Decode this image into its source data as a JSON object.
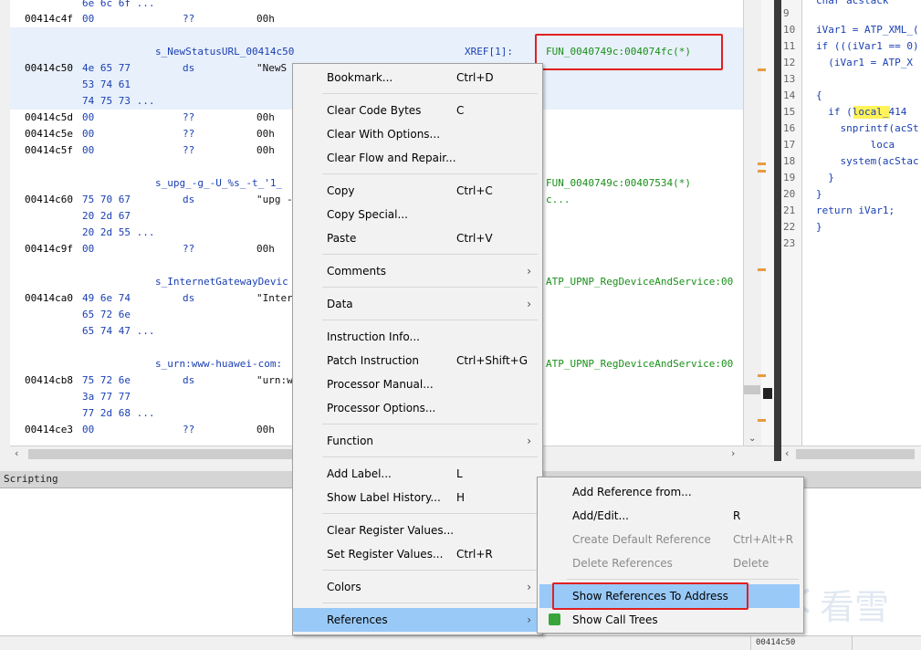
{
  "listing": {
    "lines": [
      {
        "addr": "",
        "bytes": "6e 6c 6f",
        "more": "...",
        "mnem": "",
        "val": ""
      },
      {
        "addr": "00414c4f",
        "bytes": "00",
        "more": "",
        "mnem": "??",
        "val": "00h"
      },
      {
        "label": "s_NewStatusURL_00414c50",
        "xref_label": "XREF[1]:",
        "xref": "FUN_0040749c:004074fc(*)"
      },
      {
        "addr": "00414c50",
        "bytes": "4e 65 77",
        "more": "",
        "mnem": "ds",
        "val": "\"NewS"
      },
      {
        "addr": "",
        "bytes": "53 74 61",
        "more": "",
        "mnem": "",
        "val": ""
      },
      {
        "addr": "",
        "bytes": "74 75 73",
        "more": "...",
        "mnem": "",
        "val": ""
      },
      {
        "addr": "00414c5d",
        "bytes": "00",
        "more": "",
        "mnem": "??",
        "val": "00h"
      },
      {
        "addr": "00414c5e",
        "bytes": "00",
        "more": "",
        "mnem": "??",
        "val": "00h"
      },
      {
        "addr": "00414c5f",
        "bytes": "00",
        "more": "",
        "mnem": "??",
        "val": "00h"
      },
      {
        "label": "s_upg_-g_-U_%s_-t_'1_",
        "xref_label": "",
        "xref": "FUN_0040749c:00407534(*)"
      },
      {
        "addr": "00414c60",
        "bytes": "75 70 67",
        "more": "",
        "mnem": "ds",
        "val": "\"upg -",
        "xref_tail": "c..."
      },
      {
        "addr": "",
        "bytes": "20 2d 67",
        "more": "",
        "mnem": "",
        "val": ""
      },
      {
        "addr": "",
        "bytes": "20 2d 55",
        "more": "...",
        "mnem": "",
        "val": ""
      },
      {
        "addr": "00414c9f",
        "bytes": "00",
        "more": "",
        "mnem": "??",
        "val": "00h"
      },
      {
        "label": "s_InternetGatewayDevic",
        "xref_label": "",
        "xref": "ATP_UPNP_RegDeviceAndService:00"
      },
      {
        "addr": "00414ca0",
        "bytes": "49 6e 74",
        "more": "",
        "mnem": "ds",
        "val": "\"Inter"
      },
      {
        "addr": "",
        "bytes": "65 72 6e",
        "more": "",
        "mnem": "",
        "val": ""
      },
      {
        "addr": "",
        "bytes": "65 74 47",
        "more": "...",
        "mnem": "",
        "val": ""
      },
      {
        "label": "s_urn:www-huawei-com:",
        "xref_label": "",
        "xref": "ATP_UPNP_RegDeviceAndService:00"
      },
      {
        "addr": "00414cb8",
        "bytes": "75 72 6e",
        "more": "",
        "mnem": "ds",
        "val": "\"urn:w"
      },
      {
        "addr": "",
        "bytes": "3a 77 77",
        "more": "",
        "mnem": "",
        "val": ""
      },
      {
        "addr": "",
        "bytes": "77 2d 68",
        "more": "...",
        "mnem": "",
        "val": ""
      },
      {
        "addr": "00414ce3",
        "bytes": "00",
        "more": "",
        "mnem": "??",
        "val": "00h"
      }
    ]
  },
  "decompiler": {
    "line_numbers": [
      "9",
      "10",
      "11",
      "12",
      "13",
      "14",
      "15",
      "16",
      "17",
      "18",
      "19",
      "20",
      "21",
      "22",
      "23"
    ],
    "code": [
      "",
      "iVar1 = ATP_XML_(",
      "if (((iVar1 == 0)",
      "  (iVar1 = ATP_X",
      "",
      "{",
      "  if (local_414 ",
      "    snprintf(acSt",
      "         loca",
      "    system(acStac",
      "  }",
      "}",
      "return iVar1;",
      "}",
      ""
    ],
    "top_partial": "char acstack"
  },
  "scripting": {
    "title": "Scripting"
  },
  "statusbar": {
    "address": "00414c50"
  },
  "context_menu": {
    "items": [
      {
        "label": "Bookmark...",
        "key": "Ctrl+D"
      },
      {
        "label": "Clear Code Bytes",
        "key": "C"
      },
      {
        "label": "Clear With Options...",
        "key": ""
      },
      {
        "label": "Clear Flow and Repair...",
        "key": ""
      },
      {
        "label": "Copy",
        "key": "Ctrl+C"
      },
      {
        "label": "Copy Special...",
        "key": ""
      },
      {
        "label": "Paste",
        "key": "Ctrl+V"
      },
      {
        "label": "Comments",
        "key": ""
      },
      {
        "label": "Data",
        "key": ""
      },
      {
        "label": "Instruction Info...",
        "key": ""
      },
      {
        "label": "Patch Instruction",
        "key": "Ctrl+Shift+G"
      },
      {
        "label": "Processor Manual...",
        "key": ""
      },
      {
        "label": "Processor Options...",
        "key": ""
      },
      {
        "label": "Function",
        "key": ""
      },
      {
        "label": "Add Label...",
        "key": "L"
      },
      {
        "label": "Show Label History...",
        "key": "H"
      },
      {
        "label": "Clear Register Values...",
        "key": ""
      },
      {
        "label": "Set Register Values...",
        "key": "Ctrl+R"
      },
      {
        "label": "Colors",
        "key": ""
      },
      {
        "label": "References",
        "key": ""
      }
    ],
    "arrow": "›"
  },
  "references_submenu": {
    "items": [
      {
        "label": "Add Reference from...",
        "key": "",
        "enabled": true
      },
      {
        "label": "Add/Edit...",
        "key": "R",
        "enabled": true
      },
      {
        "label": "Create Default Reference",
        "key": "Ctrl+Alt+R",
        "enabled": false
      },
      {
        "label": "Delete References",
        "key": "Delete",
        "enabled": false
      },
      {
        "label": "Show References To Address",
        "key": "",
        "enabled": true
      },
      {
        "label": "Show Call Trees",
        "key": "",
        "enabled": true
      }
    ]
  },
  "watermark": {
    "text": "看雪"
  },
  "colors": {
    "selection": "#99c9f7",
    "highlight_box": "#e02020",
    "address": "#1a3fb2",
    "xref": "#1a8f1a"
  }
}
